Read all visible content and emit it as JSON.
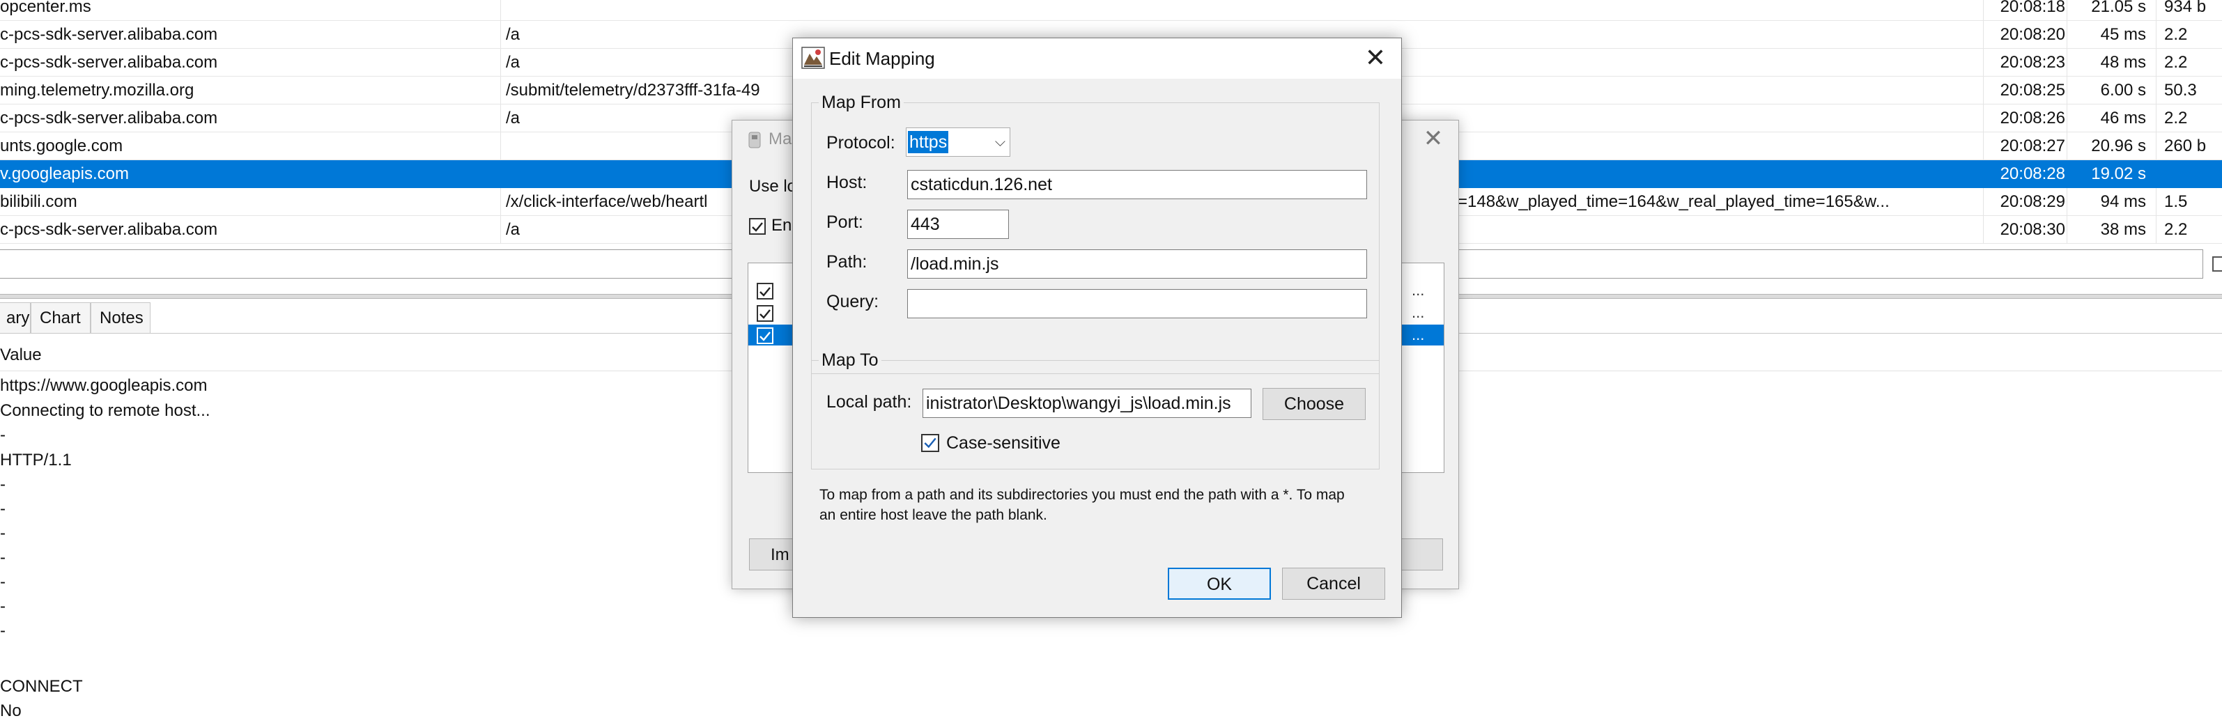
{
  "requests": [
    {
      "host": "opcenter.ms",
      "path": "",
      "time": "20:08:18",
      "duration": "21.05 s",
      "size": "934 b",
      "selected": false
    },
    {
      "host": "c-pcs-sdk-server.alibaba.com",
      "path": "/a",
      "time": "20:08:20",
      "duration": "45 ms",
      "size": "2.2",
      "selected": false
    },
    {
      "host": "c-pcs-sdk-server.alibaba.com",
      "path": "/a",
      "time": "20:08:23",
      "duration": "48 ms",
      "size": "2.2",
      "selected": false
    },
    {
      "host": "ming.telemetry.mozilla.org",
      "path": "/submit/telemetry/d2373fff-31fa-49",
      "time": "20:08:25",
      "duration": "6.00 s",
      "size": "50.3",
      "selected": false
    },
    {
      "host": "c-pcs-sdk-server.alibaba.com",
      "path": "/a",
      "time": "20:08:26",
      "duration": "46 ms",
      "size": "2.2",
      "selected": false
    },
    {
      "host": "unts.google.com",
      "path": "",
      "time": "20:08:27",
      "duration": "20.96 s",
      "size": "260 b",
      "selected": false
    },
    {
      "host": "v.googleapis.com",
      "path": "",
      "time": "20:08:28",
      "duration": "19.02 s",
      "size": "",
      "selected": true
    },
    {
      "host": "bilibili.com",
      "path": "/x/click-interface/web/heartl",
      "time": "20:08:29",
      "duration": "94 ms",
      "size": "1.5",
      "selected": false
    },
    {
      "host": "c-pcs-sdk-server.alibaba.com",
      "path": "/a",
      "time": "20:08:30",
      "duration": "38 ms",
      "size": "2.2",
      "selected": false
    }
  ],
  "request_path_overflow": "=148&w_played_time=164&w_real_played_time=165&w...",
  "tabs": [
    "ary",
    "Chart",
    "Notes"
  ],
  "value_header": "Value",
  "values": [
    "https://www.googleapis.com",
    "Connecting to remote host...",
    "-",
    "HTTP/1.1",
    "-",
    "-",
    "-",
    "-",
    "-",
    "-",
    "-",
    "",
    "CONNECT",
    "No"
  ],
  "bg_dialog": {
    "title": "Ma",
    "use_text": "Use lo",
    "enable_text": "Ena",
    "item_ellipsis": "...",
    "import_label": "Im"
  },
  "dialog": {
    "title": "Edit Mapping",
    "close_glyph": "✕",
    "map_from_legend": "Map From",
    "protocol_label": "Protocol:",
    "protocol_value": "https",
    "host_label": "Host:",
    "host_value": "cstaticdun.126.net",
    "port_label": "Port:",
    "port_value": "443",
    "path_label": "Path:",
    "path_value": "/load.min.js",
    "query_label": "Query:",
    "query_value": "",
    "map_to_legend": "Map To",
    "local_path_label": "Local path:",
    "local_path_value": "inistrator\\Desktop\\wangyi_js\\load.min.js",
    "choose_label": "Choose",
    "case_label": "Case-sensitive",
    "case_checked": true,
    "help_text": "To map from a path and its subdirectories you must end the path with a *. To map an entire host leave the path blank.",
    "ok_label": "OK",
    "cancel_label": "Cancel"
  },
  "colors": {
    "selection": "#0078d7",
    "dialog_bg": "#f0f0f0"
  }
}
